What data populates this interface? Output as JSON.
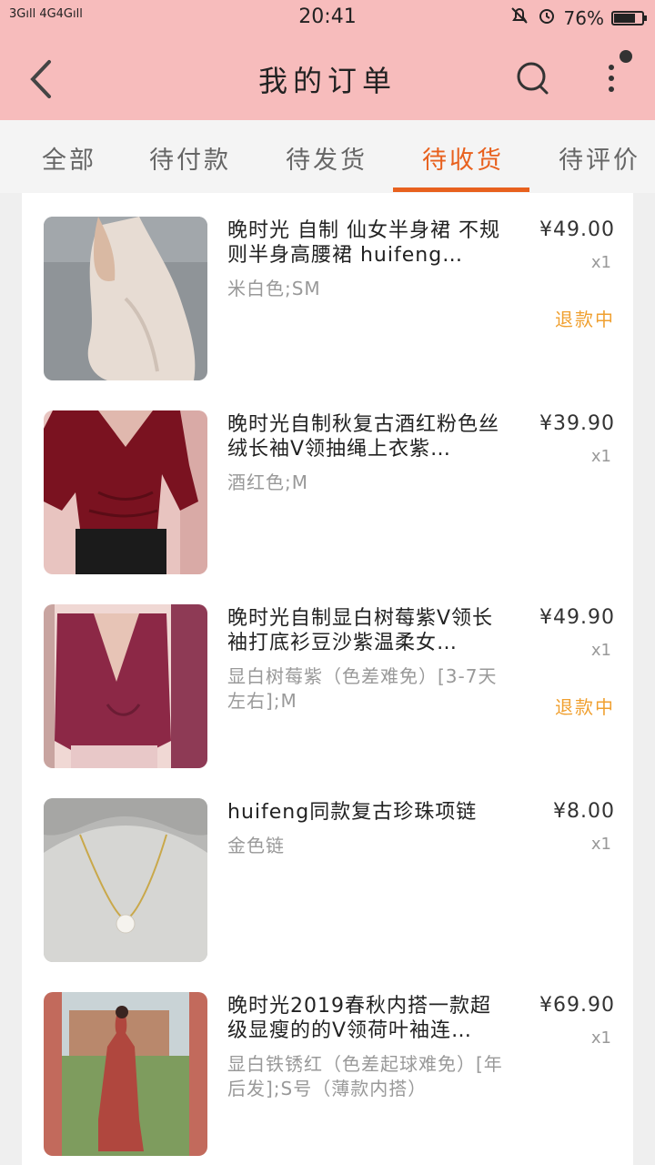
{
  "status_bar": {
    "signal": "3Gıll 4G4Gıll",
    "time": "20:41",
    "battery": "76%",
    "battery_level": 0.76
  },
  "header": {
    "title": "我的订单"
  },
  "tabs": [
    {
      "label": "全部",
      "active": false
    },
    {
      "label": "待付款",
      "active": false
    },
    {
      "label": "待发货",
      "active": false
    },
    {
      "label": "待收货",
      "active": true
    },
    {
      "label": "待评价",
      "active": false
    }
  ],
  "orders": [
    {
      "name": "晚时光 自制 仙女半身裙 不规则半身高腰裙 huifeng…",
      "spec": "米白色;SM",
      "price": "¥49.00",
      "qty": "x1",
      "status": "退款中",
      "thumb_icon": "skirt-photo"
    },
    {
      "name": "晚时光自制秋复古酒红粉色丝绒长袖V领抽绳上衣紫…",
      "spec": "酒红色;M",
      "price": "¥39.90",
      "qty": "x1",
      "status": "",
      "thumb_icon": "velvet-top-photo"
    },
    {
      "name": "晚时光自制显白树莓紫V领长袖打底衫豆沙紫温柔女…",
      "spec": "显白树莓紫（色差难免）[3-7天左右];M",
      "price": "¥49.90",
      "qty": "x1",
      "status": "退款中",
      "thumb_icon": "purple-top-photo"
    },
    {
      "name": "huifeng同款复古珍珠项链",
      "spec": "金色链",
      "price": "¥8.00",
      "qty": "x1",
      "status": "",
      "thumb_icon": "pearl-necklace-photo"
    },
    {
      "name": "晚时光2019春秋内搭一款超级显瘦的的V领荷叶袖连…",
      "spec": "显白铁锈红（色差起球难免）[年后发];S号（薄款内搭）",
      "price": "¥69.90",
      "qty": "x1",
      "status": "",
      "thumb_icon": "dress-photo"
    }
  ],
  "colors": {
    "header_bg": "#f7bcbc",
    "accent": "#e8611e",
    "status_tag": "#f0a030"
  }
}
